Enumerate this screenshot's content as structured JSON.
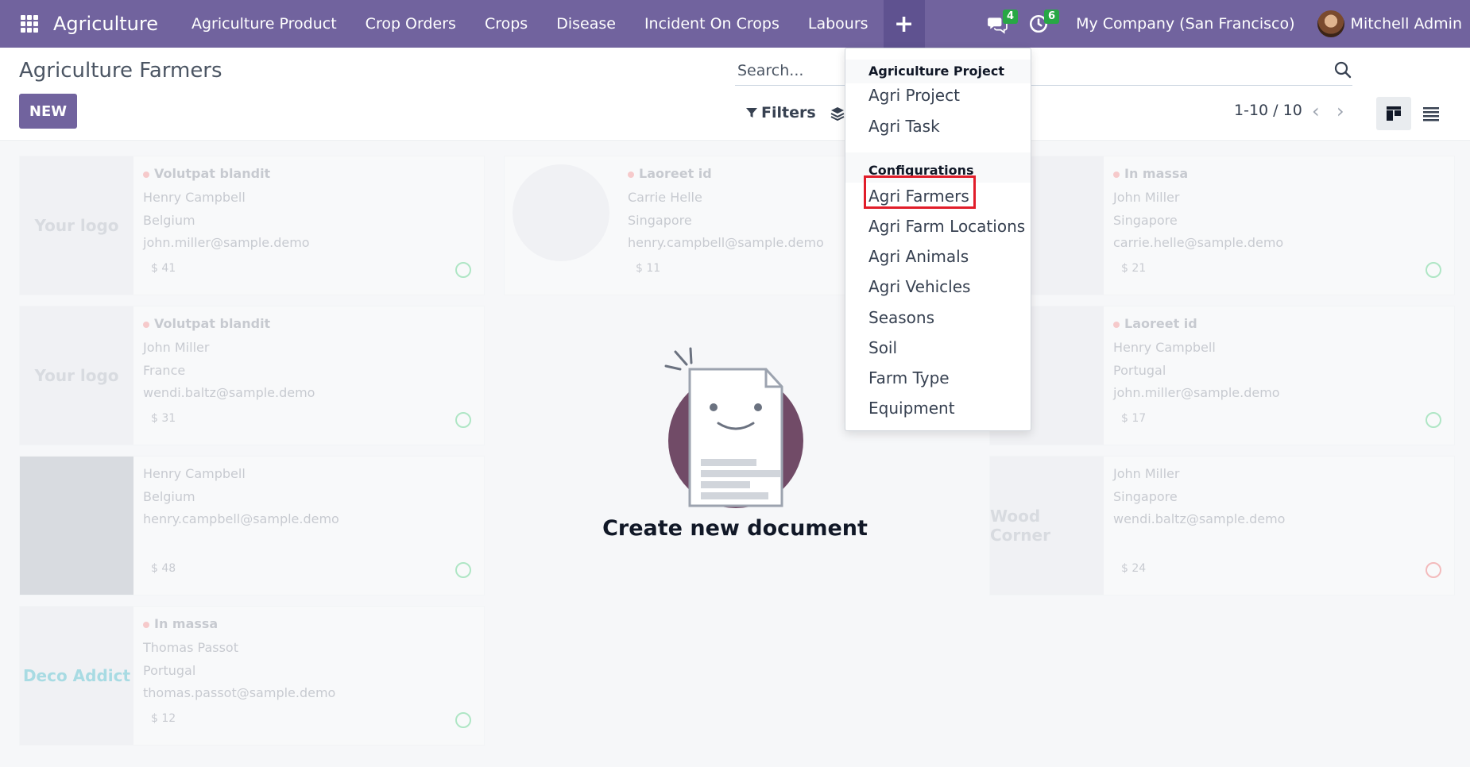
{
  "navbar": {
    "brand": "Agriculture",
    "menu": [
      "Agriculture Product",
      "Crop Orders",
      "Crops",
      "Disease",
      "Incident On Crops",
      "Labours"
    ],
    "plus_label": "+",
    "messages_count": "4",
    "activities_count": "6",
    "company": "My Company (San Francisco)",
    "user": "Mitchell Admin",
    "accent_color": "#71639e",
    "badge_color": "#28a745"
  },
  "control": {
    "title": "Agriculture Farmers",
    "new_label": "NEW",
    "search_placeholder": "Search...",
    "filters_label": "Filters",
    "pager": "1-10 / 10"
  },
  "cards": [
    {
      "tag": "Volutpat blandit",
      "name": "Henry Campbell",
      "country": "Belgium",
      "email": "john.miller@sample.demo",
      "price": "$ 41",
      "image": "Your logo"
    },
    {
      "tag": "Laoreet id",
      "name": "Carrie Helle",
      "country": "Singapore",
      "email": "henry.campbell@sample.demo",
      "price": "$ 11",
      "image": ""
    },
    {
      "tag": "In massa",
      "name": "John Miller",
      "country": "Singapore",
      "email": "carrie.helle@sample.demo",
      "price": "$ 21",
      "image": ""
    },
    {
      "tag": "Volutpat blandit",
      "name": "John Miller",
      "country": "France",
      "email": "wendi.baltz@sample.demo",
      "price": "$ 31",
      "image": "Your logo"
    },
    {
      "tag": "Laoreet id",
      "name": "Henry Campbell",
      "country": "Portugal",
      "email": "john.miller@sample.demo",
      "price": "$ 17",
      "image": ""
    },
    {
      "tag": "",
      "name": "Henry Campbell",
      "country": "Belgium",
      "email": "henry.campbell@sample.demo",
      "price": "$ 48",
      "image": ""
    },
    {
      "tag": "",
      "name": "John Miller",
      "country": "Singapore",
      "email": "wendi.baltz@sample.demo",
      "price": "$ 24",
      "image": "Wood Corner"
    },
    {
      "tag": "In massa",
      "name": "Thomas Passot",
      "country": "Portugal",
      "email": "thomas.passot@sample.demo",
      "price": "$ 12",
      "image": "Deco Addict"
    }
  ],
  "empty_state": {
    "title": "Create new document"
  },
  "dropdown": {
    "section1": "Agriculture Project",
    "items1": [
      "Agri Project",
      "Agri Task"
    ],
    "section2": "Configurations",
    "items2": [
      "Agri Farmers",
      "Agri Farm Locations",
      "Agri Animals",
      "Agri Vehicles",
      "Seasons",
      "Soil",
      "Farm Type",
      "Equipment"
    ],
    "highlighted": "Agri Farmers"
  }
}
